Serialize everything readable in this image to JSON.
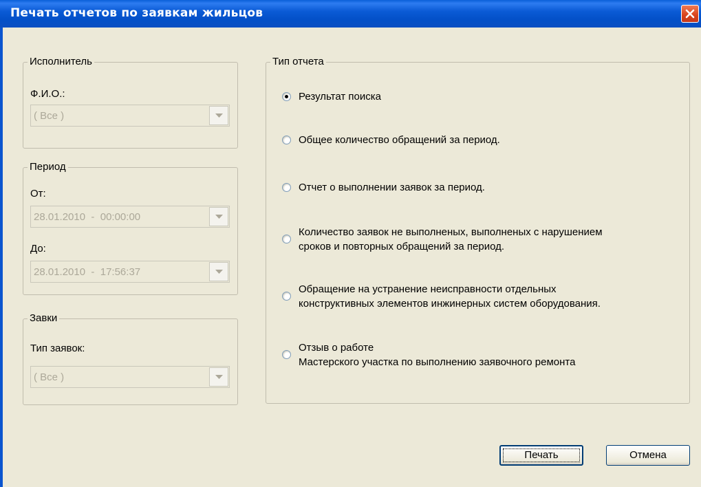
{
  "window": {
    "title": "Печать отчетов по заявкам жильцов"
  },
  "executor": {
    "legend": "Исполнитель",
    "fio_label": "Ф.И.О.:",
    "fio_value": "( Все )"
  },
  "period": {
    "legend": "Период",
    "from_label": "От:",
    "from_value": "28.01.2010  -  00:00:00",
    "to_label": "До:",
    "to_value": "28.01.2010  -  17:56:37"
  },
  "requests": {
    "legend": "Завки",
    "type_label": "Тип заявок:",
    "type_value": "( Все )"
  },
  "report_type": {
    "legend": "Тип отчета",
    "options": [
      {
        "line1": "Результат поиска",
        "line2": "",
        "selected": true
      },
      {
        "line1": "Общее количество обращений за период.",
        "line2": "",
        "selected": false
      },
      {
        "line1": "Отчет о выполнении заявок за период.",
        "line2": "",
        "selected": false
      },
      {
        "line1": "Количество заявок не выполненых, выполненых с нарушением",
        "line2": "сроков и повторных обращений за период.",
        "selected": false
      },
      {
        "line1": "Обращение на устранение неисправности отдельных",
        "line2": "конструктивных элементов инжинерных систем оборудования.",
        "selected": false
      },
      {
        "line1": "Отзыв о работе",
        "line2": "Мастерского участка по выполнению заявочного ремонта",
        "selected": false
      }
    ]
  },
  "buttons": {
    "print": "Печать",
    "cancel": "Отмена"
  },
  "icons": {
    "close": "close-icon",
    "dropdown": "chevron-down-icon"
  },
  "colors": {
    "titlebar": "#0a55d0",
    "close_button": "#d8431c",
    "background": "#ece9d8"
  }
}
